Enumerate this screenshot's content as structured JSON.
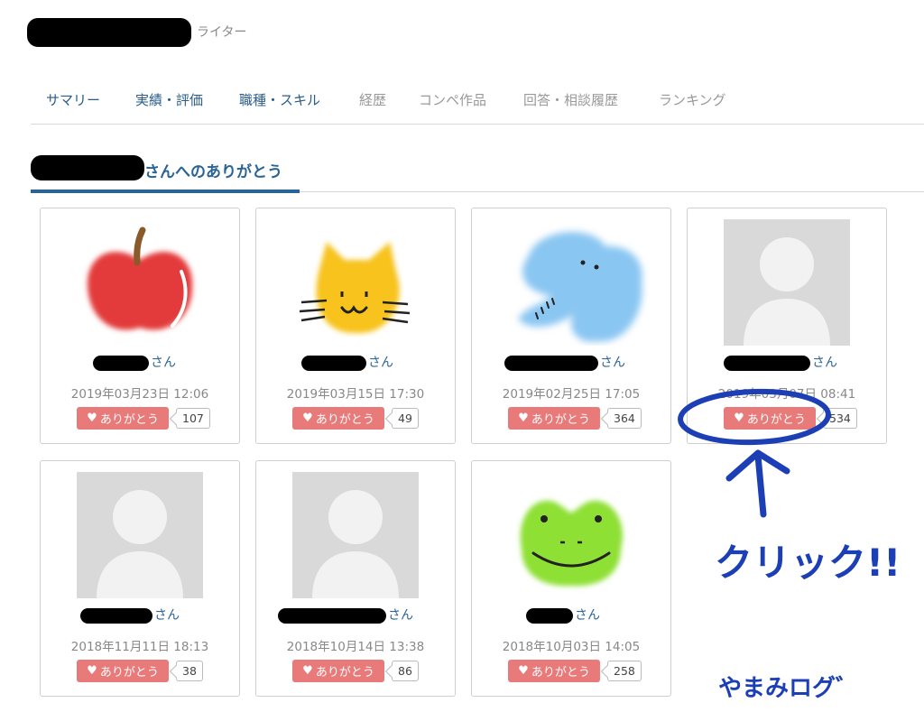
{
  "header": {
    "role": "ライター"
  },
  "nav": {
    "items": [
      {
        "label": "サマリー",
        "state": "active"
      },
      {
        "label": "実績・評価",
        "state": "active"
      },
      {
        "label": "職種・スキル",
        "state": "active"
      },
      {
        "label": "経歴",
        "state": "muted"
      },
      {
        "label": "コンペ作品",
        "state": "muted"
      },
      {
        "label": "回答・相談履歴",
        "state": "muted"
      },
      {
        "label": "ランキング",
        "state": "muted"
      }
    ]
  },
  "section": {
    "title": "さんへのありがとう"
  },
  "cards": [
    {
      "avatar": "apple-avatar",
      "suffix": "さん",
      "date": "2019年03月23日 12:06",
      "button": "ありがとう",
      "count": "107"
    },
    {
      "avatar": "cat-avatar",
      "suffix": "さん",
      "date": "2019年03月15日 17:30",
      "button": "ありがとう",
      "count": "49"
    },
    {
      "avatar": "elephant-avatar",
      "suffix": "さん",
      "date": "2019年02月25日 17:05",
      "button": "ありがとう",
      "count": "364"
    },
    {
      "avatar": "default-avatar",
      "suffix": "さん",
      "date": "2019年03月07日 08:41",
      "button": "ありがとう",
      "count": "534"
    },
    {
      "avatar": "default-avatar",
      "suffix": "さん",
      "date": "2018年11月11日 18:13",
      "button": "ありがとう",
      "count": "38"
    },
    {
      "avatar": "default-avatar",
      "suffix": "さん",
      "date": "2018年10月14日 13:38",
      "button": "ありがとう",
      "count": "86"
    },
    {
      "avatar": "frog-avatar",
      "suffix": "さん",
      "date": "2018年10月03日 14:05",
      "button": "ありがとう",
      "count": "258"
    }
  ],
  "annotation": {
    "click_text": "クリック!!",
    "watermark": "やまみログ゛"
  },
  "colors": {
    "accent": "#2a6496",
    "button": "#e87a7a",
    "annotation": "#1d3fb5"
  }
}
